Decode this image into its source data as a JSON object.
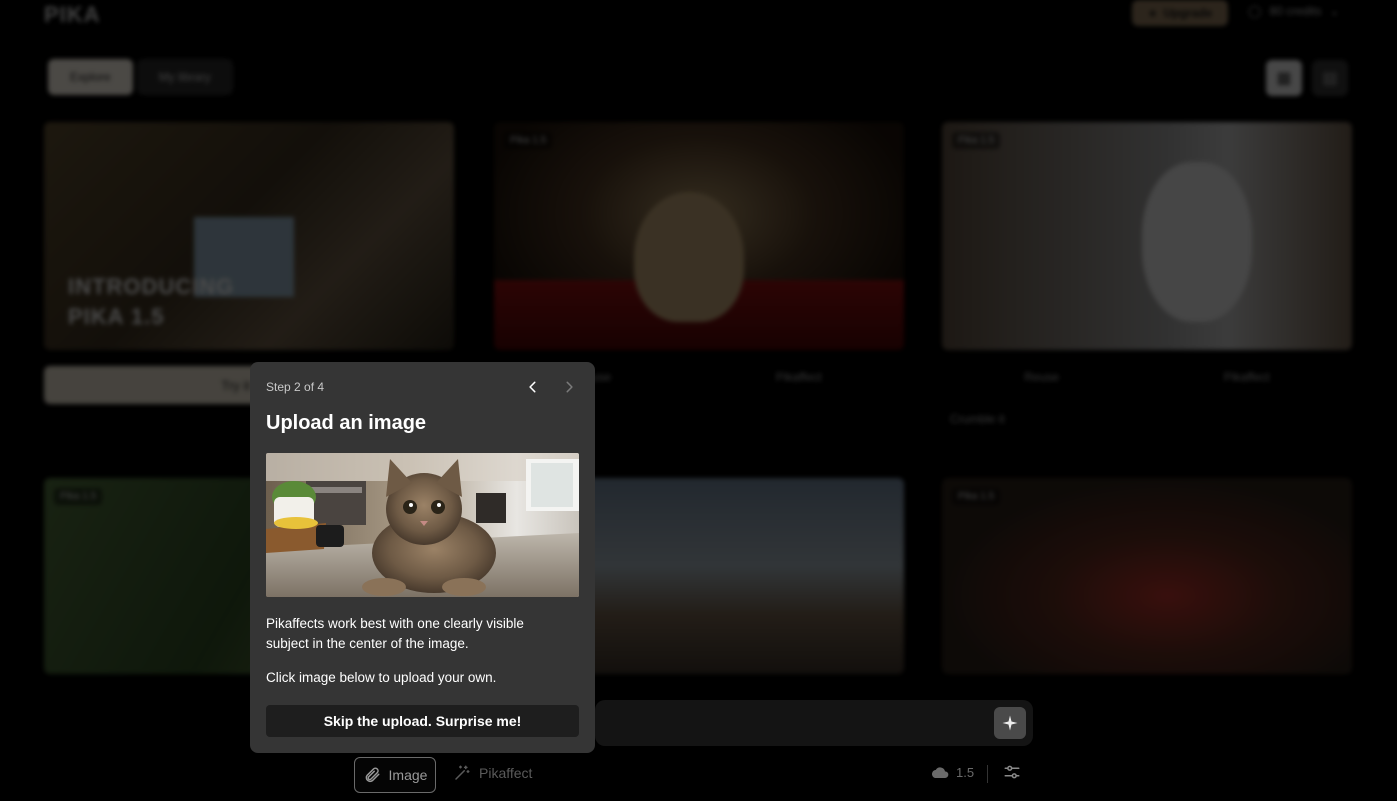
{
  "app": {
    "logo": "PIKA",
    "upgrade_label": "Upgrade",
    "credits_label": "80 credits"
  },
  "tabs": [
    {
      "label": "Explore",
      "active": true
    },
    {
      "label": "My library",
      "active": false
    }
  ],
  "gallery": {
    "featured_title_line1": "INTRODUCING",
    "featured_title_line2": "PIKA 1.5",
    "featured_button": "Try it with",
    "card_chip": "Pika 1.5",
    "action_reuse": "Reuse",
    "action_remix": "Pikaffect",
    "meta_label": "Crumble it"
  },
  "popover": {
    "step": "Step 2 of 4",
    "title": "Upload an image",
    "description": "Pikaffects work best with one clearly visible subject in the center of the image.",
    "hint": "Click image below to upload your own.",
    "skip_label": "Skip the upload. Surprise me!",
    "prev_icon": "chevron-left-icon",
    "next_icon": "chevron-right-icon"
  },
  "prompt": {
    "generate_icon": "sparkle-icon"
  },
  "bottom_tools": {
    "image_label": "Image",
    "pikaffect_label": "Pikaffect",
    "model_version": "1.5"
  },
  "colors": {
    "popover_bg": "#353535",
    "skip_button_bg": "#1e1e1e",
    "overlay": "#000000"
  }
}
